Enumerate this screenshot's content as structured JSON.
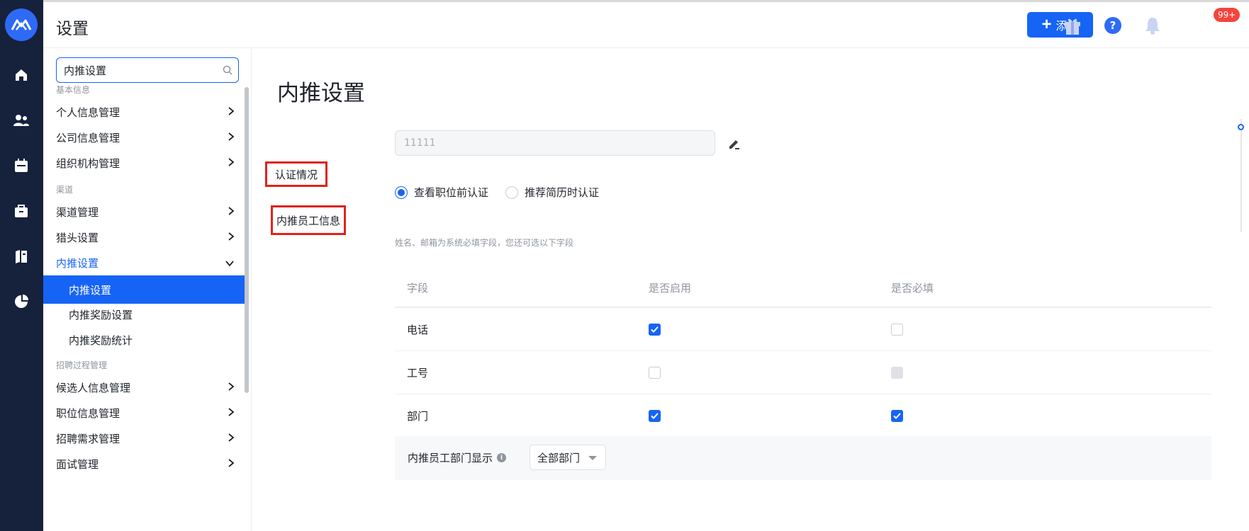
{
  "header": {
    "title": "设置",
    "add_label": "添加",
    "badge": "99+"
  },
  "rail": {
    "icons": [
      "home-icon",
      "users-icon",
      "calendar-icon",
      "briefcase-icon",
      "book-icon",
      "pie-chart-icon"
    ]
  },
  "sidebar": {
    "search_value": "内推设置",
    "sections": [
      {
        "title": "基本信息",
        "items": [
          "个人信息管理",
          "公司信息管理",
          "组织机构管理"
        ]
      },
      {
        "title": "渠道",
        "items": [
          "渠道管理",
          "猎头设置",
          "内推设置"
        ],
        "sub_items": [
          "内推设置",
          "内推奖励设置",
          "内推奖励统计"
        ]
      },
      {
        "title": "招聘过程管理",
        "items": [
          "候选人信息管理",
          "职位信息管理",
          "招聘需求管理",
          "面试管理"
        ]
      }
    ]
  },
  "main": {
    "page_title": "内推设置",
    "name_value": "11111",
    "auth_label": "认证情况",
    "auth_options": [
      "查看职位前认证",
      "推荐简历时认证"
    ],
    "auth_selected": 0,
    "employee_label": "内推员工信息",
    "hint": "姓名、邮箱为系统必填字段，您还可选以下字段",
    "table": {
      "headers": [
        "字段",
        "是否启用",
        "是否必填"
      ],
      "rows": [
        {
          "field": "电话",
          "enabled": true,
          "required": false
        },
        {
          "field": "工号",
          "enabled": false,
          "required": "disabled"
        },
        {
          "field": "部门",
          "enabled": true,
          "required": true
        }
      ]
    },
    "dept_label": "内推员工部门显示",
    "dept_select": "全部部门"
  },
  "colors": {
    "primary": "#1664f5",
    "rail": "#16213c",
    "highlight_box": "#e0231b",
    "badge": "#f5443b"
  }
}
